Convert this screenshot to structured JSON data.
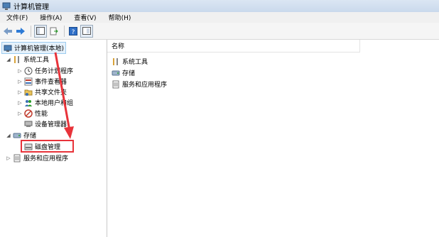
{
  "window": {
    "title": "计算机管理"
  },
  "menu": [
    {
      "label": "文件(F)"
    },
    {
      "label": "操作(A)"
    },
    {
      "label": "查看(V)"
    },
    {
      "label": "帮助(H)"
    }
  ],
  "toolbar": {
    "icons": [
      "back-arrow-icon",
      "forward-arrow-icon",
      "show-tree-icon",
      "export-list-icon",
      "help-icon",
      "properties-icon"
    ]
  },
  "tree": {
    "root": "计算机管理(本地)",
    "system_tools": "系统工具",
    "system_children": [
      "任务计划程序",
      "事件查看器",
      "共享文件夹",
      "本地用户和组",
      "性能",
      "设备管理器"
    ],
    "storage": "存储",
    "storage_children": [
      "磁盘管理"
    ],
    "services": "服务和应用程序"
  },
  "list": {
    "column_name": "名称",
    "items": [
      "系统工具",
      "存储",
      "服务和应用程序"
    ]
  },
  "colors": {
    "accent": "#e8333a",
    "selection": "#e5f1fb"
  }
}
